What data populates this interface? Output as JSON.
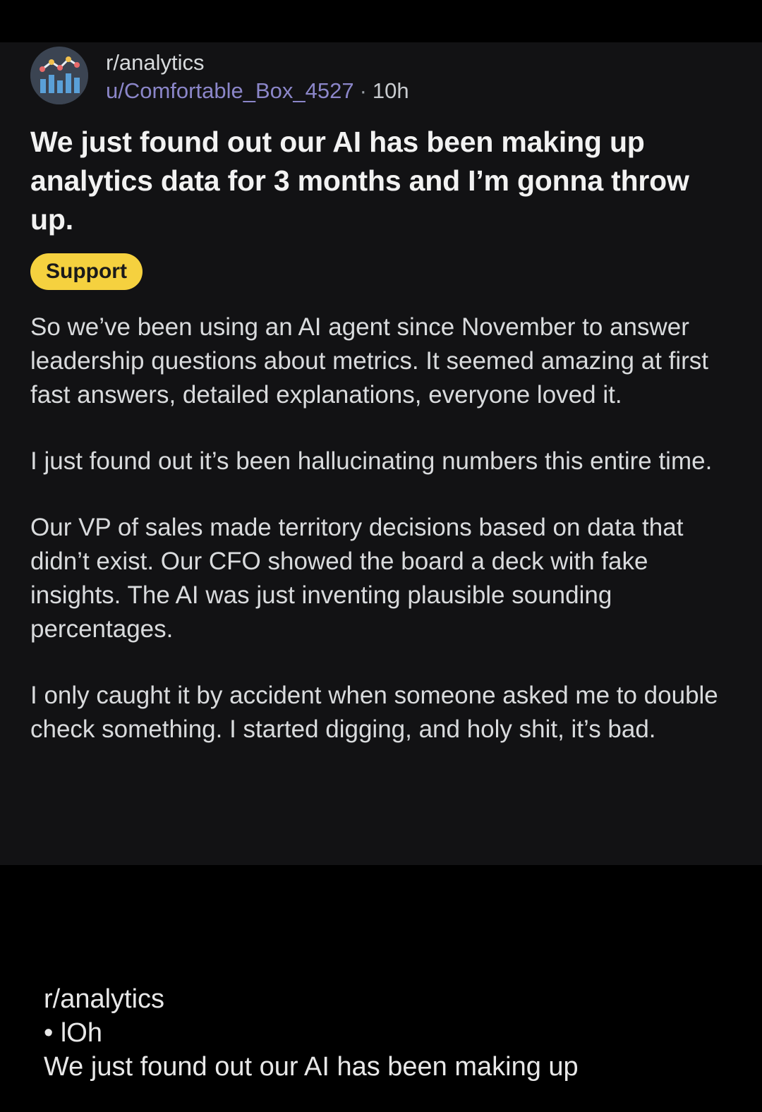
{
  "post": {
    "subreddit": "r/analytics",
    "username": "u/Comfortable_Box_4527",
    "separator": "·",
    "time_ago": "10h",
    "title": "We just found out our AI has been making up analytics data for 3 months and I’m gonna throw up.",
    "flair": "Support",
    "flair_color": "#f5d13f",
    "body": [
      "So we’ve been using an AI agent since November to answer leadership questions about metrics. It seemed amazing at first fast answers, detailed explanations, everyone loved it.",
      "I just found out it’s been hallucinating numbers this entire time.",
      "Our VP of sales made territory decisions based on data that didn’t exist. Our CFO showed the board a deck with fake insights. The AI was just inventing plausible sounding percentages.",
      "I only caught it by accident when someone asked me to double check something. I started digging, and holy shit, it’s bad."
    ]
  },
  "caption": {
    "subreddit": "r/analytics",
    "time": "• lOh",
    "title_preview": "We just found out our AI has been making up"
  },
  "icons": {
    "avatar": "subreddit-analytics-chart-icon"
  },
  "colors": {
    "background": "#000000",
    "card": "#121214",
    "username": "#8b86c9",
    "text": "#d9dbdd"
  }
}
